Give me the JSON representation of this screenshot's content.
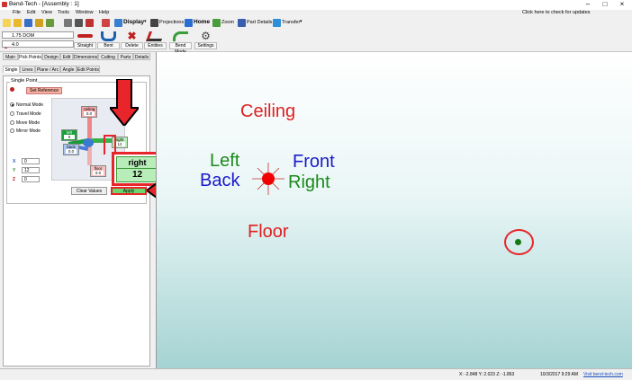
{
  "window": {
    "title": "Bend-Tech - [Assembly : 1]",
    "minimize": "–",
    "maximize": "□",
    "close": "×"
  },
  "menu": [
    "File",
    "Edit",
    "View",
    "Tools",
    "Window",
    "Help"
  ],
  "update_notice": "Click here to check for updates",
  "toolbar": {
    "display_label": "Display",
    "projections_label": "Projections",
    "home_label": "Home",
    "zoom_label": "Zoom",
    "part_details_label": "Part Details",
    "transfer_label": "Transfer"
  },
  "selectors": {
    "material": "1.75 DOM",
    "value": "4.0"
  },
  "tools": [
    {
      "label": "Straight"
    },
    {
      "label": "Bent"
    },
    {
      "label": "Delete"
    },
    {
      "label": "Entities"
    },
    {
      "label": "Bend Mode"
    },
    {
      "label": "Settings"
    }
  ],
  "main_tabs": [
    "Main",
    "Pick Points",
    "Design",
    "Edit",
    "Dimensions",
    "Cutting",
    "Parts",
    "Details"
  ],
  "sub_tabs": [
    "Single",
    "Lines",
    "Plane / Arc",
    "Angle",
    "Edit Points"
  ],
  "panel": {
    "group_title": "Single Point",
    "set_reference": "Set Reference",
    "modes": [
      {
        "label": "Normal Mode",
        "selected": true
      },
      {
        "label": "Travel Mode",
        "selected": false
      },
      {
        "label": "Move Mode",
        "selected": false
      },
      {
        "label": "Mirror Mode",
        "selected": false
      }
    ],
    "gizmo": {
      "ceiling": {
        "label": "ceiling",
        "value": "0.0"
      },
      "left": {
        "label": "left",
        "value": "0"
      },
      "back": {
        "label": "back",
        "value": "0.0"
      },
      "right": {
        "label": "right",
        "value": "12"
      },
      "floor": {
        "label": "floor",
        "value": "0.0"
      }
    },
    "coords": {
      "x_label": "X",
      "x": "0",
      "y_label": "Y",
      "y": "12",
      "z_label": "Z",
      "z": "0"
    },
    "clear_values": "Clear Values",
    "apply": "Apply"
  },
  "callout": {
    "label": "right",
    "value": "12"
  },
  "orientation": {
    "ceiling": "Ceiling",
    "left": "Left",
    "back": "Back",
    "front": "Front",
    "right": "Right",
    "floor": "Floor"
  },
  "status": {
    "coords": "X: -2.848  Y: 2.023  Z: -1.863",
    "datetime": "10/3/2017  9:29 AM",
    "link": "Visit bend-tech.com"
  },
  "colors": {
    "highlight_red": "#e8252a",
    "ceiling_text": "#e02020",
    "left_text": "#1a8a1a",
    "back_text": "#1a1acc",
    "apply_green": "#6cd66c"
  }
}
